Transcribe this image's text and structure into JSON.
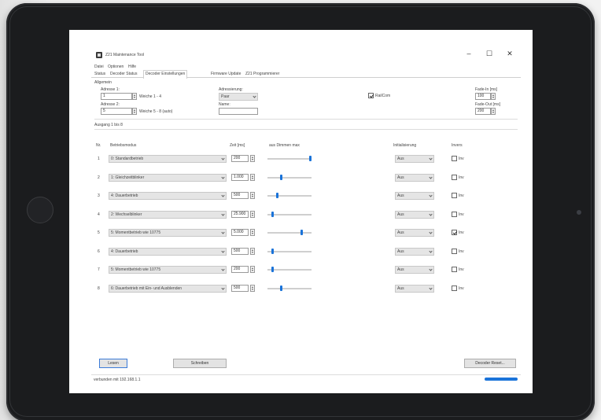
{
  "window": {
    "title": "Z21 Maintenance Tool",
    "minimize": "–",
    "maximize": "☐",
    "close": "✕"
  },
  "menu": [
    "Datei",
    "Optionen",
    "Hilfe"
  ],
  "tabs": [
    "Status",
    "Decoder Status",
    "Decoder Einstellungen",
    "Firmware Update",
    "Z21 Programmierer"
  ],
  "active_tab": 2,
  "general": {
    "section_label": "Allgemein",
    "address1_label": "Adresse 1:",
    "address1_value": "1",
    "address1_hint": "Weiche 1 - 4",
    "address2_label": "Adresse 2:",
    "address2_value": "5",
    "address2_hint": "Weiche 5 - 8 (auto)",
    "addressing_label": "Adressierung:",
    "addressing_value": "Paar",
    "name_label": "Name:",
    "name_value": "",
    "railcom_label": "RailCom",
    "railcom_checked": true,
    "fade_in_label": "Fade-In [ms]",
    "fade_in_value": "100",
    "fade_out_label": "Fade-Out [ms]",
    "fade_out_value": "200"
  },
  "outputs_label": "Ausgang 1 bis 8",
  "table_headers": {
    "nr": "Nr.",
    "mode": "Betriebsmodus",
    "time": "Zeit [ms]",
    "dim": "aus   Dimmen   max",
    "init": "Initialisierung",
    "invert": "Invers"
  },
  "rows": [
    {
      "nr": "1",
      "mode": "0: Standardbetrieb",
      "time": "200",
      "level": 1.0,
      "init": "Aus",
      "invert_label": "Inv",
      "inverted": false
    },
    {
      "nr": "2",
      "mode": "1: Gleichzeitblinker",
      "time": "1.000",
      "level": 0.3,
      "init": "Aus",
      "invert_label": "Inv",
      "inverted": false
    },
    {
      "nr": "3",
      "mode": "4: Dauerbetrieb",
      "time": "500",
      "level": 0.2,
      "init": "Aus",
      "invert_label": "Inv",
      "inverted": false
    },
    {
      "nr": "4",
      "mode": "2: Wechselblinker",
      "time": "25.900",
      "level": 0.1,
      "init": "Aus",
      "invert_label": "Inv",
      "inverted": false
    },
    {
      "nr": "5",
      "mode": "5: Momentbetrieb wie 10775",
      "time": "5.000",
      "level": 0.8,
      "init": "Aus",
      "invert_label": "Inv",
      "inverted": true
    },
    {
      "nr": "6",
      "mode": "4: Dauerbetrieb",
      "time": "500",
      "level": 0.1,
      "init": "Aus",
      "invert_label": "Inv",
      "inverted": false
    },
    {
      "nr": "7",
      "mode": "5: Momentbetrieb wie 10775",
      "time": "200",
      "level": 0.1,
      "init": "Aus",
      "invert_label": "Inv",
      "inverted": false
    },
    {
      "nr": "8",
      "mode": "6: Dauerbetrieb mit Ein- und Ausblenden",
      "time": "500",
      "level": 0.3,
      "init": "Aus",
      "invert_label": "Inv",
      "inverted": false
    }
  ],
  "buttons": {
    "read": "Lesen",
    "write": "Schreiben",
    "reset": "Decoder Reset..."
  },
  "status_text": "verbunden mit 192.168.1.1",
  "colors": {
    "accent": "#1a73d9",
    "tablet": "#1b1c1e"
  }
}
